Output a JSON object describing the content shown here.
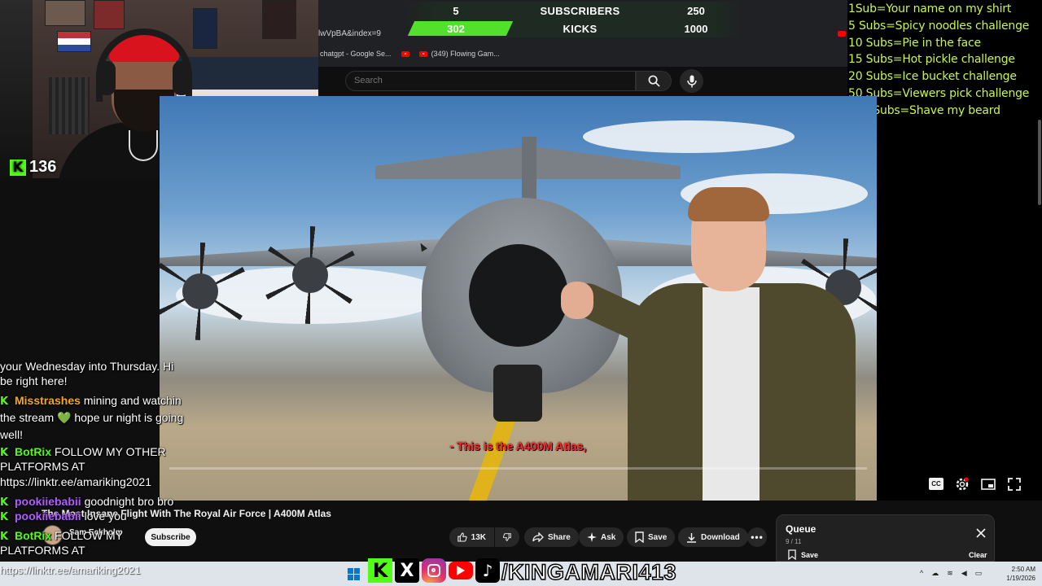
{
  "browser": {
    "url_fragment": "lwVpBA&index=9",
    "bookmarks": [
      {
        "label": "chatgpt - Google Se..."
      },
      {
        "label": ""
      },
      {
        "label": "(349) Flowing Gam..."
      }
    ]
  },
  "youtube": {
    "search_placeholder": "Search",
    "video": {
      "caption": "- This is the A400M Atlas,",
      "title": "The Most Insane Flight With The Royal Air Force | A400M Atlas",
      "channel": "Sam Eckholm",
      "subscribe_label": "Subscribe",
      "actions": {
        "likes": "13K",
        "share": "Share",
        "ask": "Ask",
        "save": "Save",
        "download": "Download"
      }
    },
    "queue": {
      "title": "Queue",
      "count": "9 / 11",
      "save_label": "Save",
      "clear_label": "Clear"
    }
  },
  "stream_overlay": {
    "viewer_count": "136",
    "goals": {
      "subs_current": "5",
      "subs_label": "SUBSCRIBERS",
      "subs_target": "250",
      "kicks_current": "302",
      "kicks_label": "KICKS",
      "kicks_target": "1000",
      "kicks_progress": 0.302
    },
    "sub_goals": [
      "1Sub=Your name on my shirt",
      "5 Subs=Spicy noodles challenge",
      "10 Subs=Pie in the face",
      "15 Subs=Hot pickle challenge",
      "20 Subs=Ice bucket challenge",
      "50 Subs=Viewers pick challenge",
      "100 Subs=Shave my beard"
    ],
    "social_handle": "/KINGAMARI413",
    "linktree": "https://linktr.ee/amariking2021"
  },
  "chat": [
    {
      "user": "",
      "text": "your Wednesday into Thursday. Hi",
      "color": "#ffffff"
    },
    {
      "user": "",
      "text": "be right here!",
      "color": "#ffffff"
    },
    {
      "user": "Misstrashes",
      "text": "mining and watchin",
      "color": "#f5a623"
    },
    {
      "user": "",
      "text": "the stream 💚 hope ur night is going",
      "color": "#ffffff"
    },
    {
      "user": "",
      "text": "well!",
      "color": "#ffffff"
    },
    {
      "user": "BotRix",
      "text": "FOLLOW MY OTHER",
      "color": "#53fc18"
    },
    {
      "user": "",
      "text": "PLATFORMS AT",
      "color": "#ffffff"
    },
    {
      "user": "",
      "text": "https://linktr.ee/amariking2021",
      "color": "#ffffff"
    },
    {
      "user": "pookiiebabii",
      "text": "goodnight bro bro",
      "color": "#b05cff"
    },
    {
      "user": "pookiiebabii",
      "text": "love you",
      "color": "#b05cff"
    },
    {
      "user": "BotRix",
      "text": "FOLLOW MY",
      "color": "#53fc18"
    },
    {
      "user": "",
      "text": "PLATFORMS AT",
      "color": "#ffffff"
    }
  ],
  "taskbar": {
    "time": "2:50 AM",
    "date": "1/19/2026"
  },
  "colors": {
    "kick_green": "#53fc18",
    "sub_goal_text": "#c8f550",
    "yt_bg": "#0f0f0f",
    "caption_red": "#ff2a2a"
  }
}
